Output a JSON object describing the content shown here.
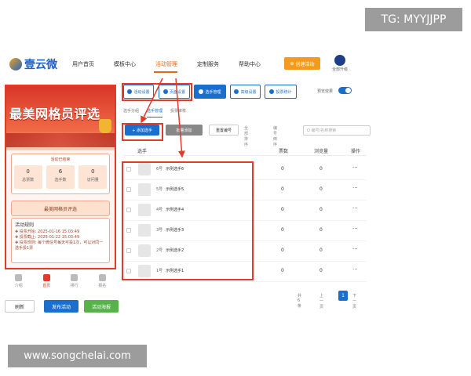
{
  "watermarks": {
    "tg": "TG: MYYJJPP",
    "site": "www.songchelai.com"
  },
  "brand": {
    "name": "壹云微"
  },
  "nav": [
    "用户首页",
    "模板中心",
    "活动管理",
    "定制服务",
    "帮助中心"
  ],
  "header": {
    "publish_btn": "创建活动",
    "user": "全部升级"
  },
  "preview": {
    "title": "最美网格员评选",
    "status": "活动已结束",
    "stats": [
      {
        "value": "0",
        "label": "总票数"
      },
      {
        "value": "6",
        "label": "选手数"
      },
      {
        "value": "0",
        "label": "访问量"
      }
    ],
    "sub_title": "最美网格员评选",
    "rules_title": "活动规则",
    "rules": [
      "投票开始: 2025-01-16 15:03:49",
      "投票截止: 2025-01-22 15:03:49",
      "投票规则: 每个微信号每天可投1次，可以对同一选手投1票"
    ],
    "tabs": [
      "介绍",
      "首页",
      "排行",
      "报名"
    ],
    "buttons": {
      "refresh": "刷新",
      "publish": "发布活动",
      "preview": "活动海报"
    }
  },
  "toolbar": [
    "活动设置",
    "页面设置",
    "选手管理",
    "高级设置",
    "投票统计"
  ],
  "toggle_label": "预览效果",
  "subtabs": [
    "选手分组",
    "选手管理",
    "投票审核"
  ],
  "actions": {
    "add": "+ 添加选手",
    "batch": "批量添加",
    "reorder": "重置编号",
    "filter_all": "全部排序",
    "sort": "编号倒序",
    "search_placeholder": "Q 编号/名称搜索"
  },
  "table": {
    "headers": [
      "选手",
      "票数",
      "浏览量",
      "操作"
    ],
    "rows": [
      {
        "rank": "6号",
        "name": "示例选手6",
        "votes": "0",
        "views": "0"
      },
      {
        "rank": "5号",
        "name": "示例选手5",
        "votes": "0",
        "views": "0"
      },
      {
        "rank": "4号",
        "name": "示例选手4",
        "votes": "0",
        "views": "0"
      },
      {
        "rank": "3号",
        "name": "示例选手3",
        "votes": "0",
        "views": "0"
      },
      {
        "rank": "2号",
        "name": "示例选手2",
        "votes": "0",
        "views": "0"
      },
      {
        "rank": "1号",
        "name": "示例选手1",
        "votes": "0",
        "views": "0"
      }
    ],
    "more": "···"
  },
  "pager": {
    "total": "共 6 条",
    "prev": "上一页",
    "current": "1",
    "next": "下一页"
  }
}
